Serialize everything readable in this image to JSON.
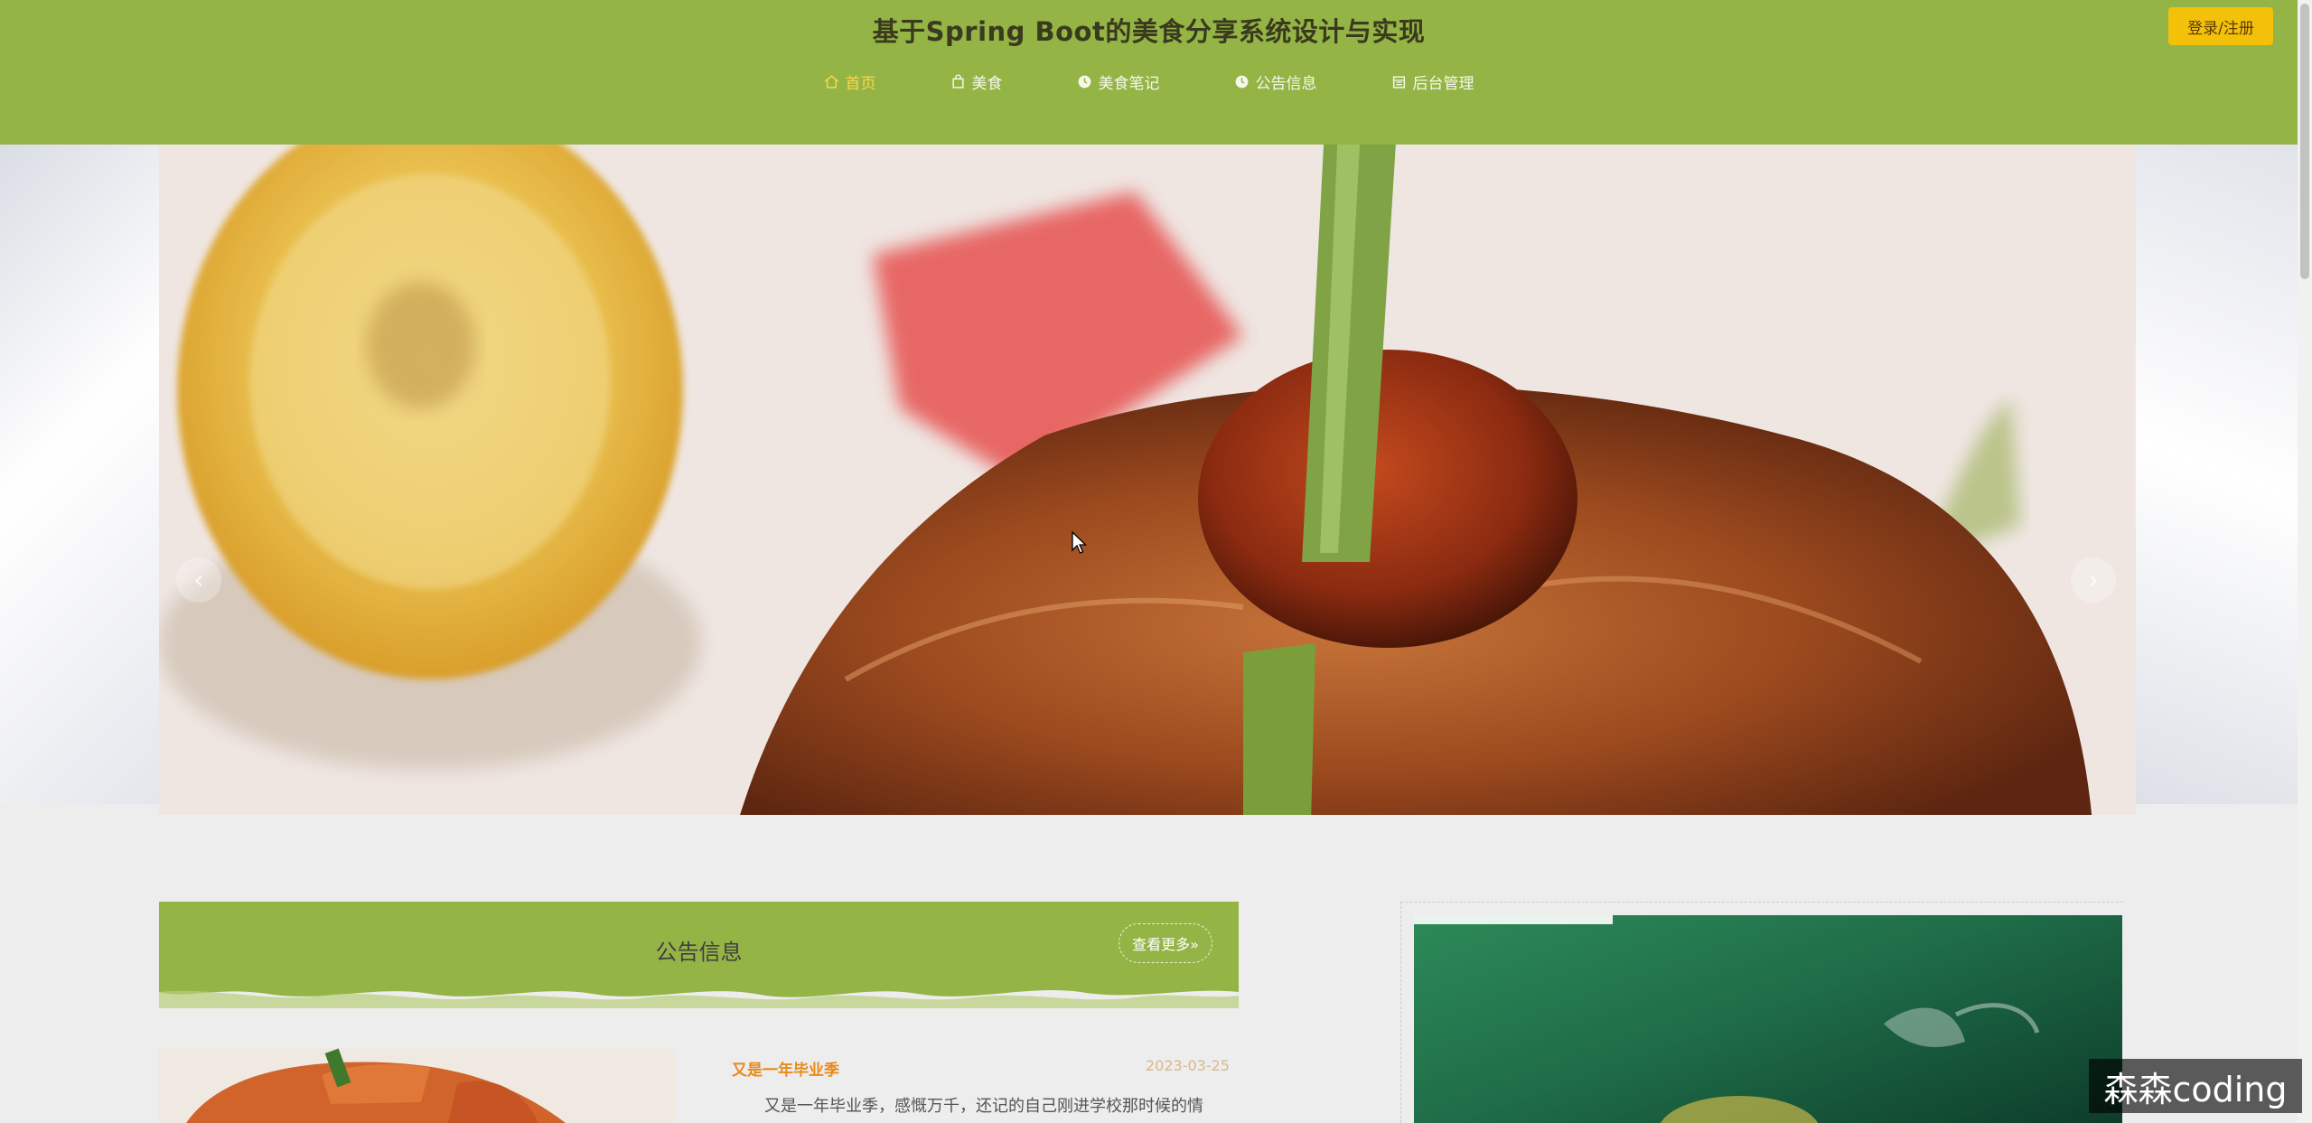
{
  "header": {
    "title": "基于Spring Boot的美食分享系统设计与实现",
    "login_button": "登录/注册",
    "background_color": "#94b446",
    "nav": [
      {
        "label": "首页",
        "icon": "home-icon",
        "active": true
      },
      {
        "label": "美食",
        "icon": "bag-icon",
        "active": false
      },
      {
        "label": "美食笔记",
        "icon": "clock-icon",
        "active": false
      },
      {
        "label": "公告信息",
        "icon": "clock-icon",
        "active": false
      },
      {
        "label": "后台管理",
        "icon": "calendar-icon",
        "active": false
      }
    ]
  },
  "banner": {
    "prev_arrow": "‹",
    "next_arrow": "›",
    "image": "grilled-fish-with-lemon"
  },
  "notice": {
    "title": "公告信息",
    "more_button": "查看更多»",
    "items": [
      {
        "title": "又是一年毕业季",
        "date": "2023-03-25",
        "summary": "又是一年毕业季，感慨万千，还记的自己刚进学校那时候的情"
      }
    ]
  },
  "watermark": "森森coding",
  "colors": {
    "accent": "#94b446",
    "active_nav": "#f7d94a",
    "login_button": "#f3c10a",
    "news_title": "#e88a1a"
  }
}
